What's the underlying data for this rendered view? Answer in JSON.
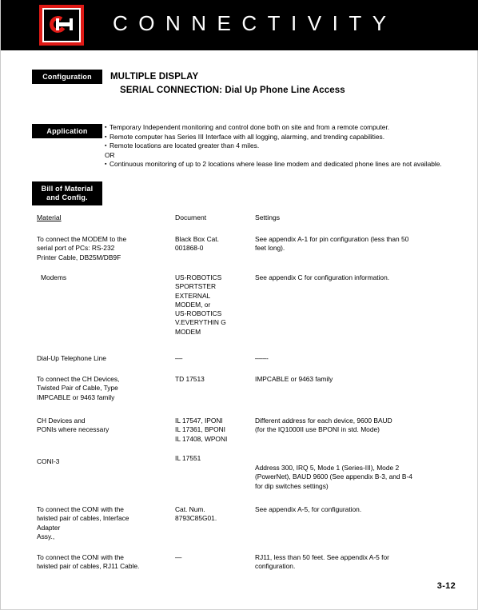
{
  "header": {
    "brand_title": "CONNECTIVITY",
    "logo_name": "cutler-hammer-logo"
  },
  "sections": {
    "configuration": {
      "tag": "Configuration",
      "title_line1": "MULTIPLE DISPLAY",
      "title_line2": "SERIAL CONNECTION: Dial Up Phone Line Access"
    },
    "application": {
      "tag": "Application",
      "bullets": [
        "Temporary Independent monitoring and control done both on site and from a remote computer.",
        "Remote computer has Series III Interface with all logging, alarming, and trending capabilities.",
        "Remote locations are located greater than 4 miles."
      ],
      "separator": "OR",
      "bullets2": [
        "Continuous monitoring of up to 2 locations where lease line modem and dedicated phone lines are not available."
      ]
    },
    "bill_of_material": {
      "tag_line1": "Bill of Material",
      "tag_line2": "and Config."
    }
  },
  "table": {
    "columns": {
      "material": "Material",
      "document": "Document",
      "settings": "Settings"
    },
    "rows": [
      {
        "material": "To connect the MODEM  to the\nserial port of PCs: RS-232\nPrinter Cable, DB25M/DB9F",
        "document": "Black Box Cat.\n001868-0",
        "settings": "See appendix A-1 for pin configuration (less than 50\nfeet long)."
      },
      {
        "material": "Modems",
        "document": "US-ROBOTICS\nSPORTSTER\nEXTERNAL\nMODEM, or\nUS-ROBOTICS\nV.EVERYTHIN G\nMODEM",
        "settings": "See appendix C for configuration information."
      },
      {
        "material": "Dial-Up Telephone Line",
        "document": "––",
        "settings": "–––-"
      },
      {
        "material": "To connect the  CH Devices,\nTwisted Pair of Cable, Type\nIMPCABLE or 9463 family",
        "document": "TD 17513",
        "settings": "IMPCABLE or 9463 family"
      },
      {
        "material": "CH Devices and\nPONIs where necessary",
        "document": "IL 17547, IPONI\nIL 17361, BPONI\nIL 17408, WPONI",
        "settings": "Different address for each device, 9600 BAUD\n(for the IQ1000II use BPONI in std. Mode)"
      },
      {
        "material": "CONI-3",
        "document": "IL 17551",
        "settings": "Address 300, IRQ 5, Mode 1 (Series-III), Mode 2\n(PowerNet), BAUD 9600 (See appendix B-3, and B-4\nfor dip switches settings)"
      },
      {
        "material": "To connect the CONI with the\ntwisted pair of cables, Interface\nAdapter\nAssy.,",
        "document": "Cat. Num.\n8793C85G01.",
        "settings": "See appendix A-5, for configuration."
      },
      {
        "material": "To connect the  CONI with the\ntwisted pair of cables, RJ11 Cable.",
        "document": "—",
        "settings": "RJ11, less than 50 feet. See appendix A-5 for\nconfiguration."
      }
    ]
  },
  "footer": {
    "page_number": "3-12"
  },
  "colors": {
    "brand_red": "#e01a16",
    "bar_black": "#000000",
    "paper": "#ffffff"
  }
}
